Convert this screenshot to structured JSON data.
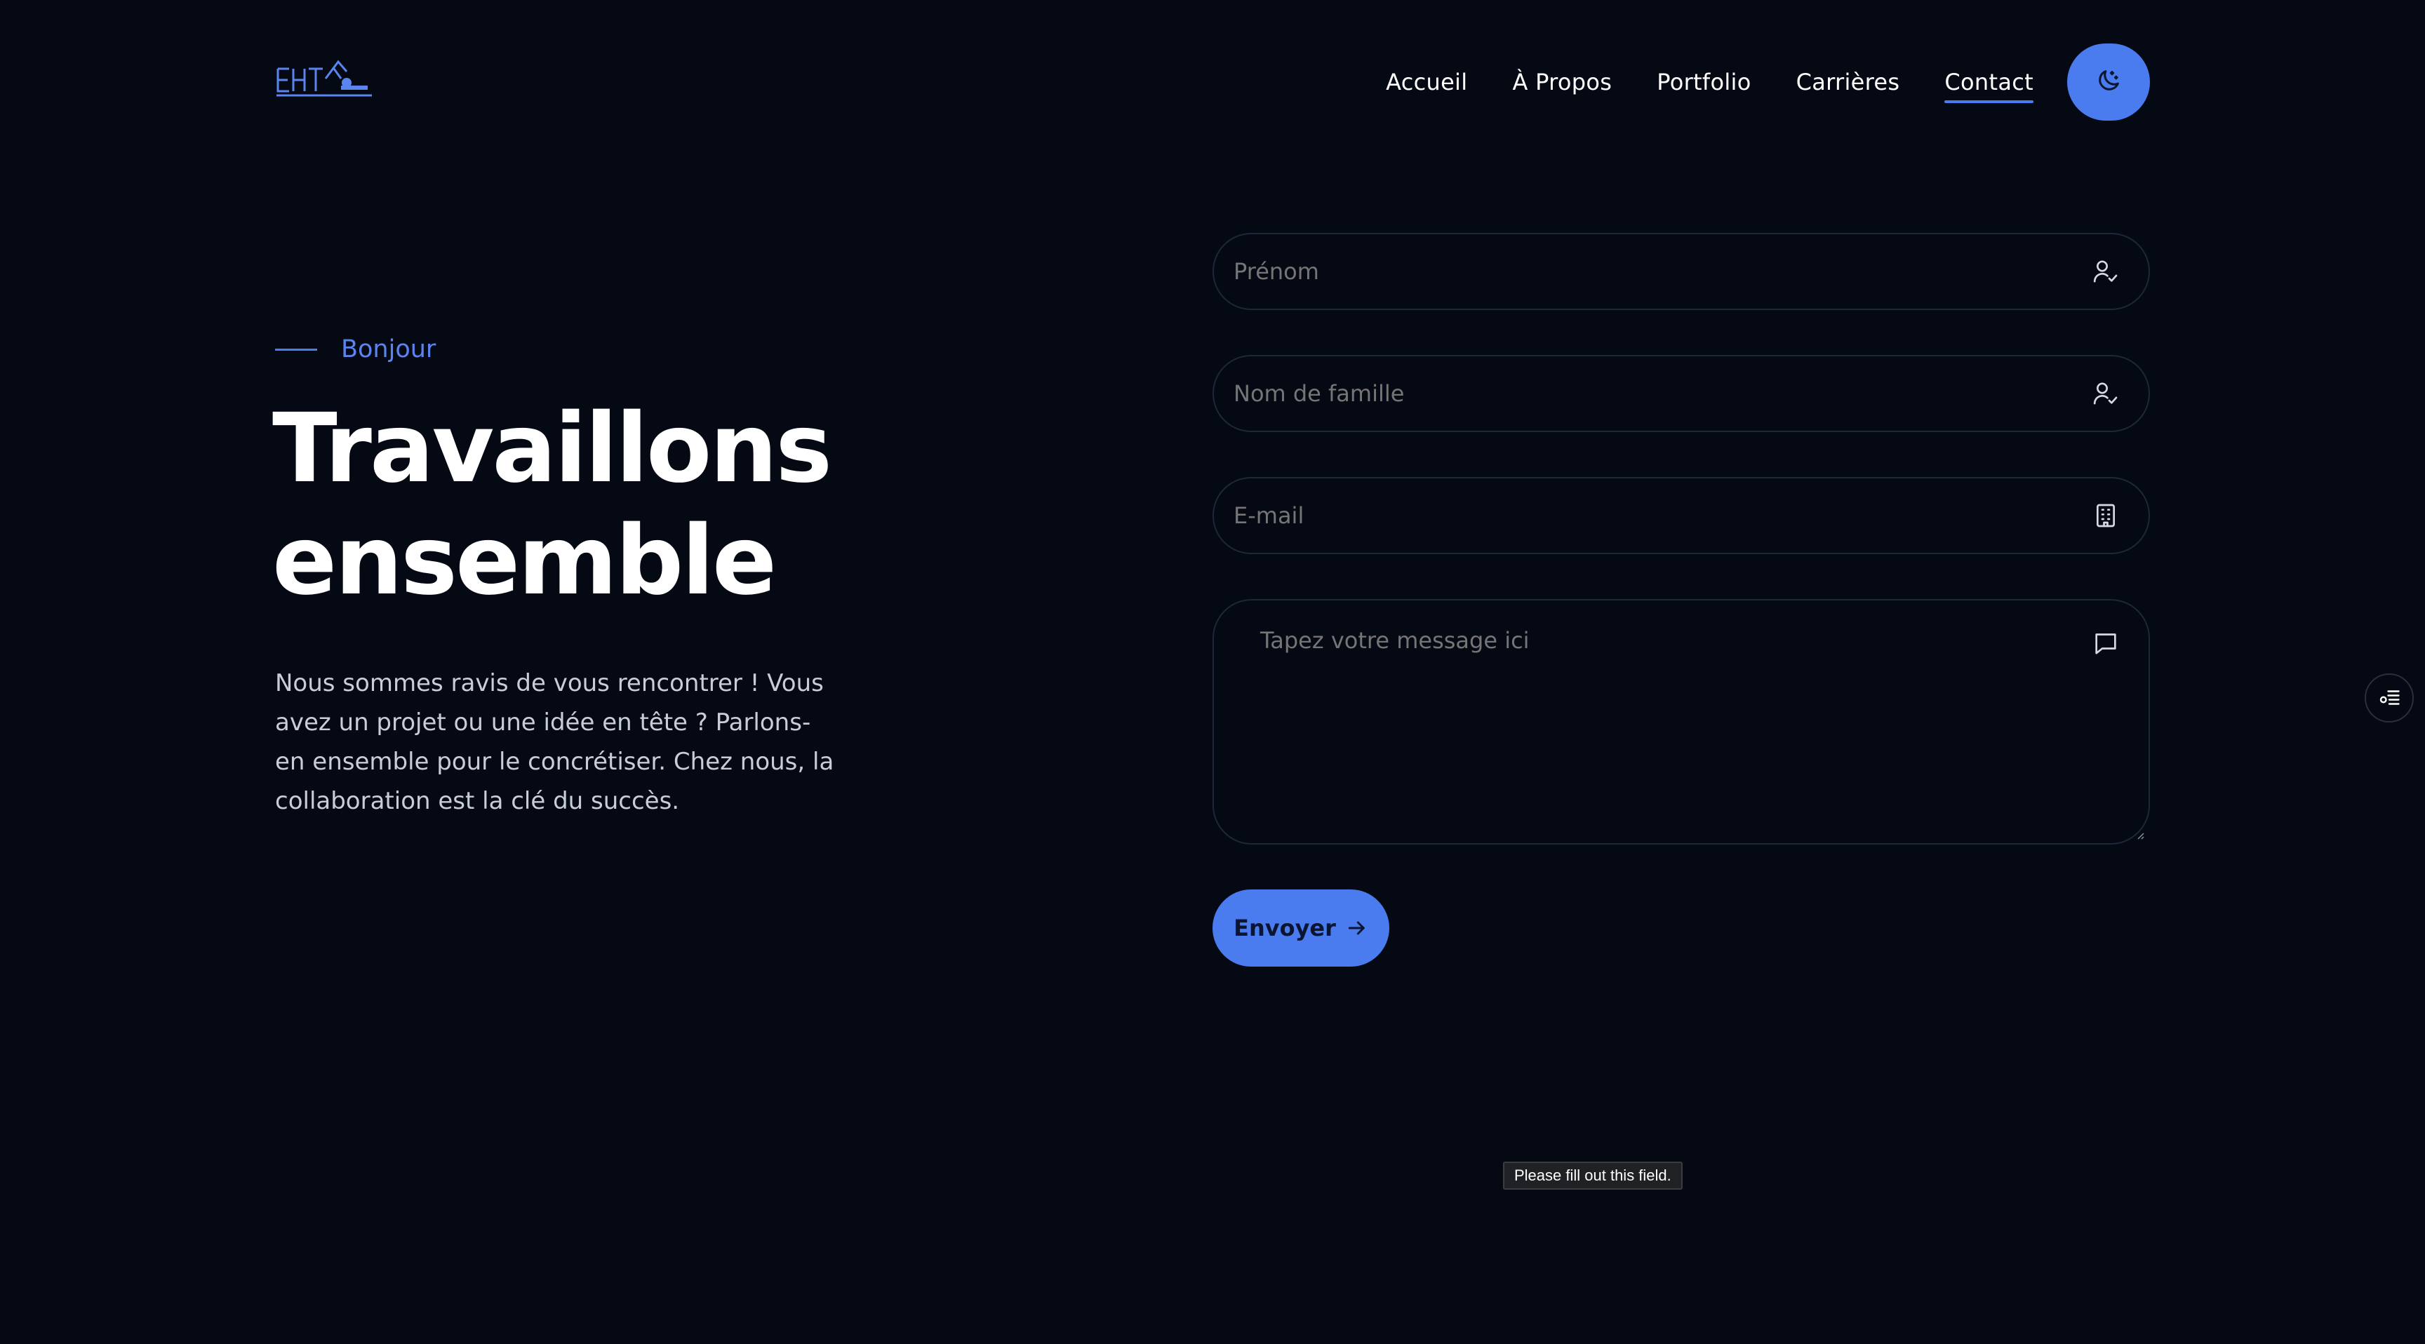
{
  "brand": {
    "logo_text": "EHT",
    "accent_color": "#4a7cf0",
    "background_color": "#050914"
  },
  "nav": {
    "items": [
      {
        "label": "Accueil",
        "active": false
      },
      {
        "label": "À Propos",
        "active": false
      },
      {
        "label": "Portfolio",
        "active": false
      },
      {
        "label": "Carrières",
        "active": false
      },
      {
        "label": "Contact",
        "active": true
      }
    ],
    "theme_toggle_icon": "moon-icon"
  },
  "hero": {
    "eyebrow": "Bonjour",
    "title_line1": "Travaillons",
    "title_line2": "ensemble",
    "description": "Nous sommes ravis de vous rencontrer ! Vous avez un projet ou une idée en tête ? Parlons-en ensemble pour le concrétiser. Chez nous, la collaboration est la clé du succès."
  },
  "form": {
    "first_name": {
      "value": "",
      "placeholder": "Prénom",
      "icon": "user-check-icon"
    },
    "last_name": {
      "value": "",
      "placeholder": "Nom de famille",
      "icon": "user-check-icon"
    },
    "email": {
      "value": "",
      "placeholder": "E-mail",
      "icon": "building-icon"
    },
    "message": {
      "value": "",
      "placeholder": "Tapez votre message ici",
      "icon": "chat-icon"
    },
    "submit_label": "Envoyer",
    "submit_icon": "arrow-right-icon"
  },
  "validation_tooltip": "Please fill out this field.",
  "side_widget_icon": "accessibility-settings-icon"
}
